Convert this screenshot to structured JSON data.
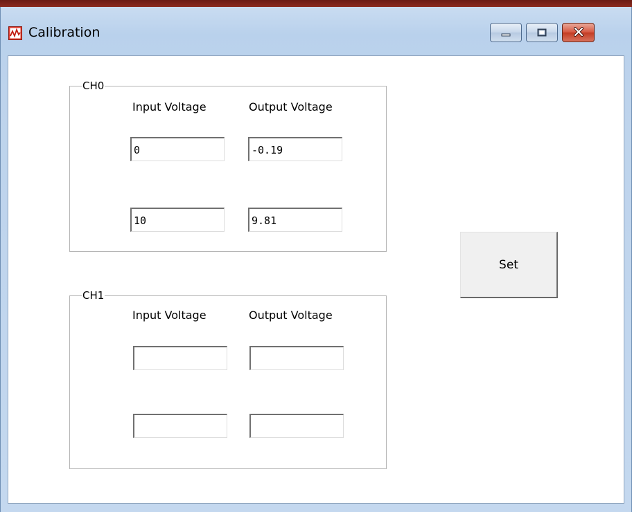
{
  "window": {
    "title": "Calibration",
    "icon": "waveform-icon",
    "controls": [
      "minimize-icon",
      "maximize-icon",
      "close-icon"
    ]
  },
  "groups": [
    {
      "label": "CH0",
      "input_header": "Input Voltage",
      "output_header": "Output Voltage",
      "rows": [
        {
          "input": "0",
          "output": "-0.19"
        },
        {
          "input": "10",
          "output": "9.81"
        }
      ]
    },
    {
      "label": "CH1",
      "input_header": "Input Voltage",
      "output_header": "Output Voltage",
      "rows": [
        {
          "input": "",
          "output": ""
        },
        {
          "input": "",
          "output": ""
        }
      ]
    }
  ],
  "actions": {
    "set_label": "Set"
  },
  "colors": {
    "titlebar": "#bdd3ec",
    "close_button": "#c23b22",
    "client_background": "#ffffff"
  }
}
